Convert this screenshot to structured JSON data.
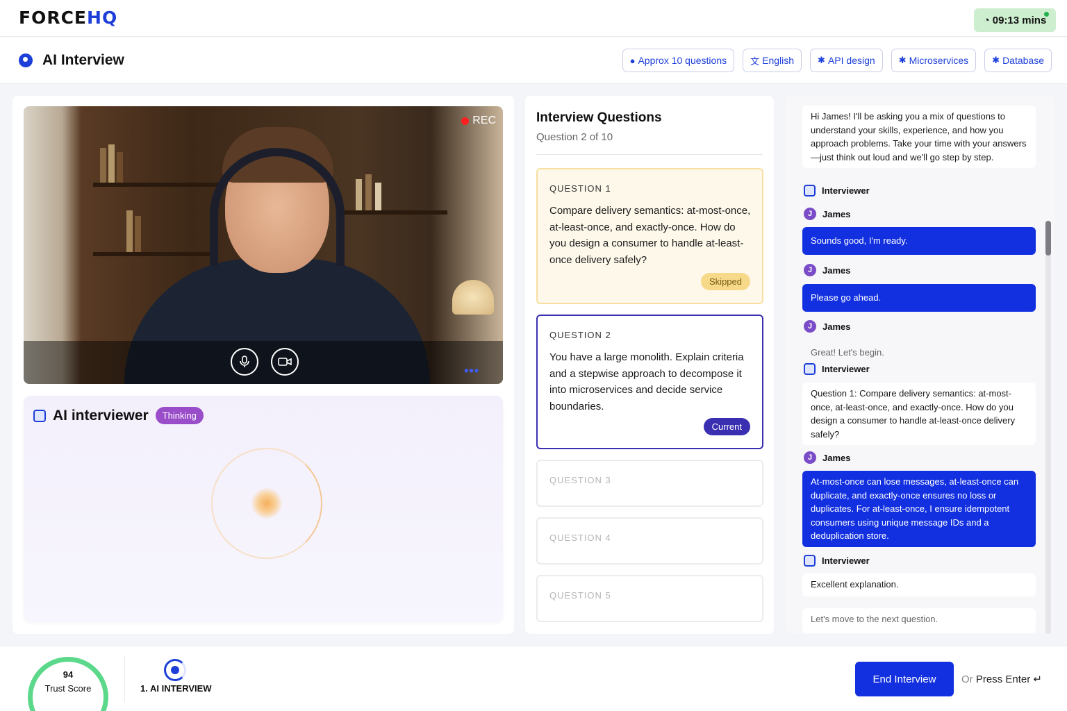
{
  "topbar": {
    "logo_main": "FORCE",
    "logo_accent": "HQ",
    "timer": "09:13 mins",
    "timer_icon": "stopwatch-icon"
  },
  "subheader": {
    "title": "AI Interview",
    "chips": [
      {
        "icon": "info-icon",
        "label": "Approx 10 questions"
      },
      {
        "icon": "translate-icon",
        "label": "English"
      },
      {
        "icon": "brain-icon",
        "label": "API design"
      },
      {
        "icon": "brain-icon",
        "label": "Microservices"
      },
      {
        "icon": "brain-icon",
        "label": "Database"
      }
    ]
  },
  "video": {
    "rec_label": "REC",
    "mic_icon": "microphone-icon",
    "camera_icon": "video-camera-icon",
    "more_icon": "more-dots-icon"
  },
  "ai_panel": {
    "title": "AI interviewer",
    "status": "Thinking"
  },
  "questions": {
    "title": "Interview Questions",
    "progress": "Question 2 of 10",
    "items": [
      {
        "label": "QUESTION 1",
        "text": "Compare delivery semantics: at-most-once, at-least-once, and exactly-once. How do you design a consumer to handle at-least-once delivery safely?",
        "status": "Skipped"
      },
      {
        "label": "QUESTION 2",
        "text": "You have a large monolith. Explain criteria and a stepwise approach to decompose it into microservices and decide service boundaries.",
        "status": "Current"
      },
      {
        "label": "QUESTION 3"
      },
      {
        "label": "QUESTION 4"
      },
      {
        "label": "QUESTION 5"
      }
    ]
  },
  "chat": {
    "messages": [
      {
        "text": "Hi James! I'll be asking you a mix of questions to understand your skills, experience, and how you approach problems. Take your time with your answers—just think out loud and we'll go step by step."
      },
      {
        "who": "Interviewer"
      },
      {
        "who": "James"
      },
      {
        "text": "Sounds good, I'm ready."
      },
      {
        "who": "James"
      },
      {
        "text": "Please go ahead."
      },
      {
        "who": "James"
      },
      {
        "text": "Great! Let's begin."
      },
      {
        "who": "Interviewer"
      },
      {
        "text": "Question 1: Compare delivery semantics: at-most-once, at-least-once, and exactly-once. How do you design a consumer to handle at-least-once delivery safely?"
      },
      {
        "who": "James"
      },
      {
        "text": "At-most-once can lose messages, at-least-once can duplicate, and exactly-once ensures no loss or duplicates. For at-least-once, I ensure idempotent consumers using unique message IDs and a deduplication store."
      },
      {
        "who": "Interviewer"
      },
      {
        "text": "Excellent explanation."
      },
      {
        "text": "Let's move to the next question."
      }
    ],
    "avatar_initial": "J"
  },
  "footer": {
    "trust_score": "94",
    "trust_label": "Trust Score",
    "trust_fraction": 0.94,
    "step_label": "1. AI INTERVIEW",
    "end_button": "End Interview",
    "press_or": "Or",
    "press_label": "Press Enter",
    "enter_icon": "enter-key-icon"
  },
  "colors": {
    "brand": "#1d3fd8",
    "user_bubble": "#1230e0",
    "thinking_badge": "#9a4dc9",
    "current_badge": "#3a2fb0",
    "skipped_badge": "#f7d98a",
    "timer_bg": "#cdeecf",
    "trust_gauge": "#5cd88a"
  }
}
